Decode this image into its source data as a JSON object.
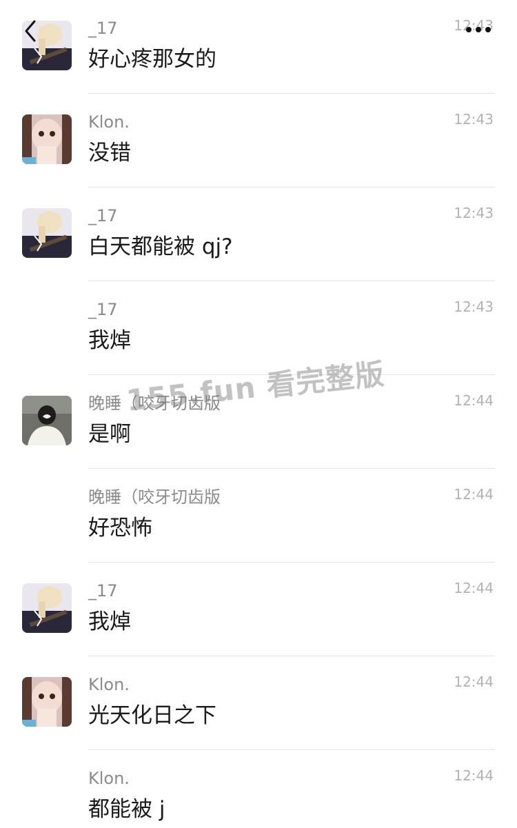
{
  "header": {
    "back_icon": "chevron-left-icon",
    "more_icon": "more-dots-icon"
  },
  "messages": [
    {
      "sender": "_17",
      "time": "12:43",
      "text": "好心疼那女的",
      "avatar": "avatar-17"
    },
    {
      "sender": "Klon.",
      "time": "12:43",
      "text": "没错",
      "avatar": "avatar-klon"
    },
    {
      "sender": "_17",
      "time": "12:43",
      "text": "白天都能被 qj?",
      "avatar": "avatar-17"
    },
    {
      "sender": "_17",
      "time": "12:43",
      "text": "我焯",
      "avatar": null
    },
    {
      "sender": "晚睡（咬牙切齿版",
      "time": "12:44",
      "text": "是啊",
      "avatar": "avatar-wanshui"
    },
    {
      "sender": "晚睡（咬牙切齿版",
      "time": "12:44",
      "text": "好恐怖",
      "avatar": null
    },
    {
      "sender": "_17",
      "time": "12:44",
      "text": "我焯",
      "avatar": "avatar-17"
    },
    {
      "sender": "Klon.",
      "time": "12:44",
      "text": "光天化日之下",
      "avatar": "avatar-klon"
    },
    {
      "sender": "Klon.",
      "time": "12:44",
      "text": "都能被 j",
      "avatar": null
    }
  ],
  "watermark": "155.fun 看完整版"
}
